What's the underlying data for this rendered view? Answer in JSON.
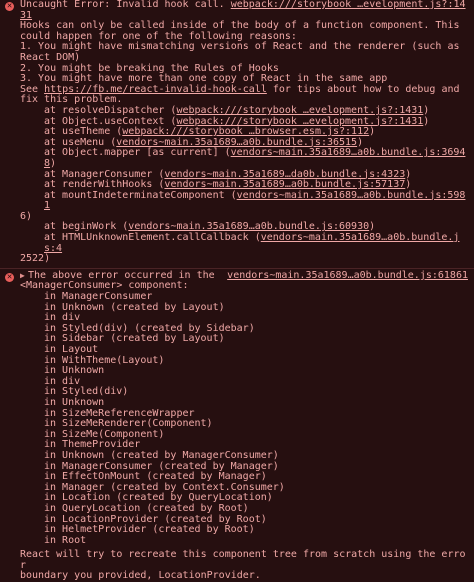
{
  "error1": {
    "header_text": "Uncaught Error: Invalid hook call. ",
    "header_link": "webpack:///storybook …evelopment.js?:1431",
    "message_lines": [
      "Hooks can only be called inside of the body of a function component. This",
      "could happen for one of the following reasons:",
      "1. You might have mismatching versions of React and the renderer (such as",
      "React DOM)",
      "2. You might be breaking the Rules of Hooks",
      "3. You might have more than one copy of React in the same app"
    ],
    "see_prefix": "See ",
    "see_link": "https://fb.me/react-invalid-hook-call",
    "see_suffix": " for tips about how to debug and",
    "see_line2": "fix this problem.",
    "stack": [
      {
        "fn": "at resolveDispatcher (",
        "src": "webpack:///storybook …evelopment.js?:1431",
        "end": ")"
      },
      {
        "fn": "at Object.useContext (",
        "src": "webpack:///storybook …evelopment.js?:1431",
        "end": ")"
      },
      {
        "fn": "at useTheme (",
        "src": "webpack:///storybook …browser.esm.js?:112",
        "end": ")"
      },
      {
        "fn": "at useMenu (",
        "src": "vendors~main.35a1689…a0b.bundle.js:36515",
        "end": ")"
      },
      {
        "fn": "at Object.mapper [as current] (",
        "src": "vendors~main.35a1689…a0b.bundle.js:36948",
        "end": ")"
      },
      {
        "fn": "at ManagerConsumer (",
        "src": "vendors~main.35a1689…da0b.bundle.js:4323",
        "end": ")"
      },
      {
        "fn": "at renderWithHooks (",
        "src": "vendors~main.35a1689…a0b.bundle.js:57137",
        "end": ")"
      },
      {
        "fn": "at mountIndeterminateComponent (",
        "src": "vendors~main.35a1689…a0b.bundle.js:5981",
        "end": ""
      },
      {
        "fn": "6)",
        "src": "",
        "end": ""
      },
      {
        "fn": "at beginWork (",
        "src": "vendors~main.35a1689…a0b.bundle.js:60930",
        "end": ")"
      },
      {
        "fn": "at HTMLUnknownElement.callCallback (",
        "src": "vendors~main.35a1689…a0b.bundle.js:4",
        "end": ""
      },
      {
        "fn": "2522)",
        "src": "",
        "end": ""
      }
    ]
  },
  "error2": {
    "header_text": "The above error occurred in the",
    "header_text2": "<ManagerConsumer> component:",
    "header_link": "vendors~main.35a1689…a0b.bundle.js:61861",
    "components": [
      "in ManagerConsumer",
      "in Unknown (created by Layout)",
      "in div",
      "in Styled(div) (created by Sidebar)",
      "in Sidebar (created by Layout)",
      "in Layout",
      "in WithTheme(Layout)",
      "in Unknown",
      "in div",
      "in Styled(div)",
      "in Unknown",
      "in SizeMeReferenceWrapper",
      "in SizeMeRenderer(Component)",
      "in SizeMe(Component)",
      "in ThemeProvider",
      "in Unknown (created by ManagerConsumer)",
      "in ManagerConsumer (created by Manager)",
      "in EffectOnMount (created by Manager)",
      "in Manager (created by Context.Consumer)",
      "in Location (created by QueryLocation)",
      "in QueryLocation (created by Root)",
      "in LocationProvider (created by Root)",
      "in HelmetProvider (created by Root)",
      "in Root"
    ],
    "footer_lines": [
      "React will try to recreate this component tree from scratch using the error",
      "boundary you provided, LocationProvider."
    ]
  },
  "colors": {
    "background": "#260f10",
    "text": "#f0a8a6",
    "error_icon": "#e85e5b",
    "divider": "#4a2325"
  },
  "icons": {
    "error": "error-circle-icon",
    "expand": "expand-triangle-icon"
  }
}
